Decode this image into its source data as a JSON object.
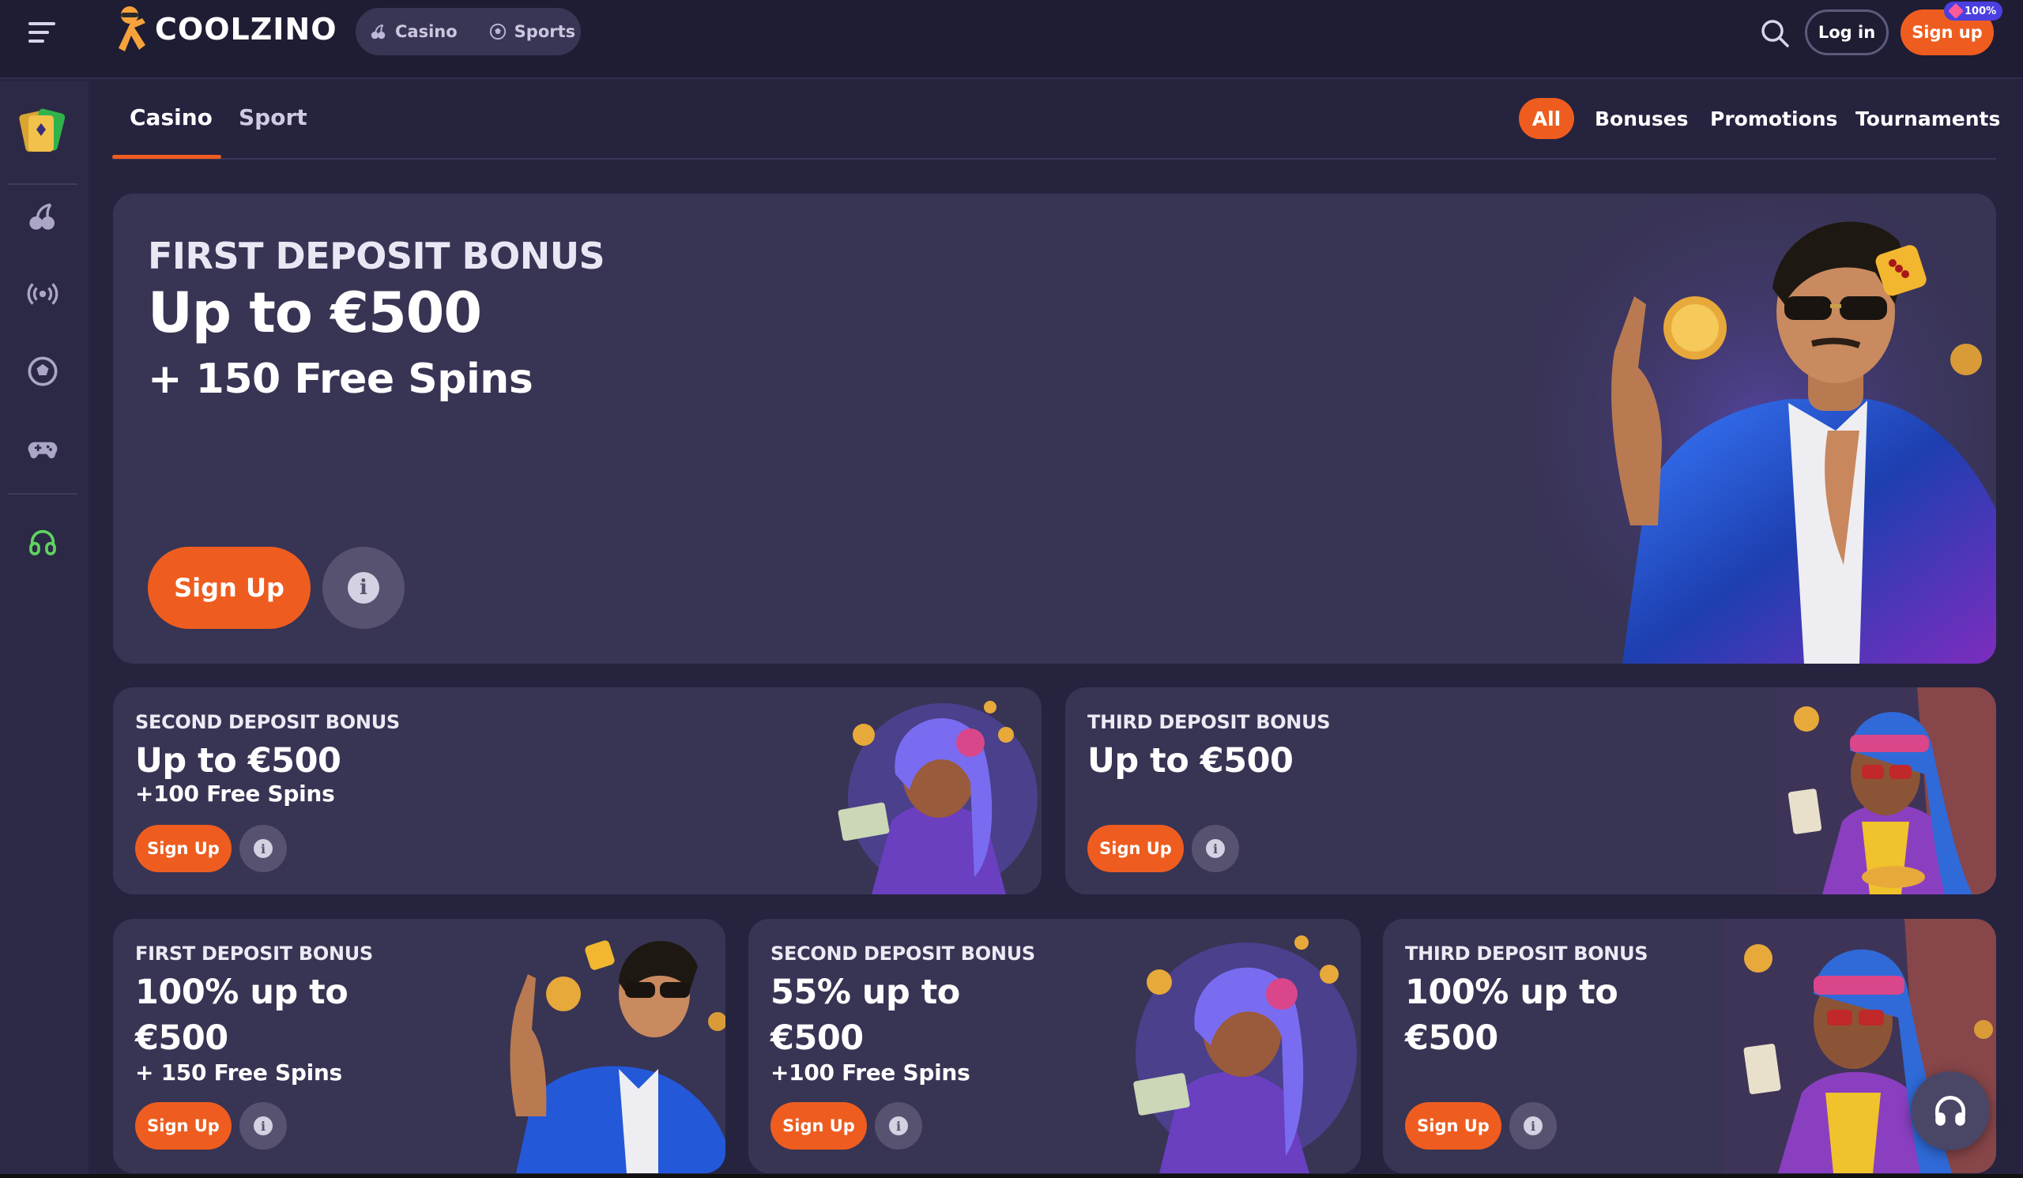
{
  "header": {
    "logo_text": "COOLZINO",
    "modes": [
      {
        "label": "Casino",
        "icon": "cherries-icon"
      },
      {
        "label": "Sports",
        "icon": "football-icon"
      }
    ],
    "login_label": "Log in",
    "signup_label": "Sign up",
    "signup_badge": "100%"
  },
  "sidebar": {
    "items": [
      {
        "name": "casino",
        "icon": "cherries-icon"
      },
      {
        "name": "live",
        "icon": "broadcast-icon"
      },
      {
        "name": "sports",
        "icon": "football-icon"
      },
      {
        "name": "games",
        "icon": "gamepad-icon"
      },
      {
        "name": "support",
        "icon": "headset-icon",
        "color": "#5fd35f"
      }
    ]
  },
  "tabs": {
    "casino": "Casino",
    "sport": "Sport"
  },
  "filters": {
    "all": "All",
    "bonuses": "Bonuses",
    "promotions": "Promotions",
    "tournaments": "Tournaments"
  },
  "hero": {
    "kicker": "FIRST DEPOSIT BONUS",
    "title": "Up to €500",
    "subtitle": "+ 150 Free Spins",
    "signup_label": "Sign Up"
  },
  "cards": [
    {
      "kicker": "SECOND DEPOSIT BONUS",
      "title": "Up to €500",
      "subtitle": "+100 Free Spins",
      "signup_label": "Sign Up"
    },
    {
      "kicker": "THIRD DEPOSIT BONUS",
      "title": "Up to €500",
      "subtitle": "",
      "signup_label": "Sign Up"
    },
    {
      "kicker": "FIRST DEPOSIT BONUS",
      "title_line1": "100% up to",
      "title_line2": "€500",
      "subtitle": "+ 150 Free Spins",
      "signup_label": "Sign Up"
    },
    {
      "kicker": "SECOND DEPOSIT BONUS",
      "title_line1": "55% up to",
      "title_line2": "€500",
      "subtitle": "+100 Free Spins",
      "signup_label": "Sign Up"
    },
    {
      "kicker": "THIRD DEPOSIT BONUS",
      "title_line1": "100% up to",
      "title_line2": "€500",
      "subtitle": "",
      "signup_label": "Sign Up"
    }
  ],
  "colors": {
    "accent": "#ee5d1f",
    "background": "#26233f",
    "card": "#383454",
    "sidebar": "#2c2946",
    "header": "#1f1d34"
  }
}
